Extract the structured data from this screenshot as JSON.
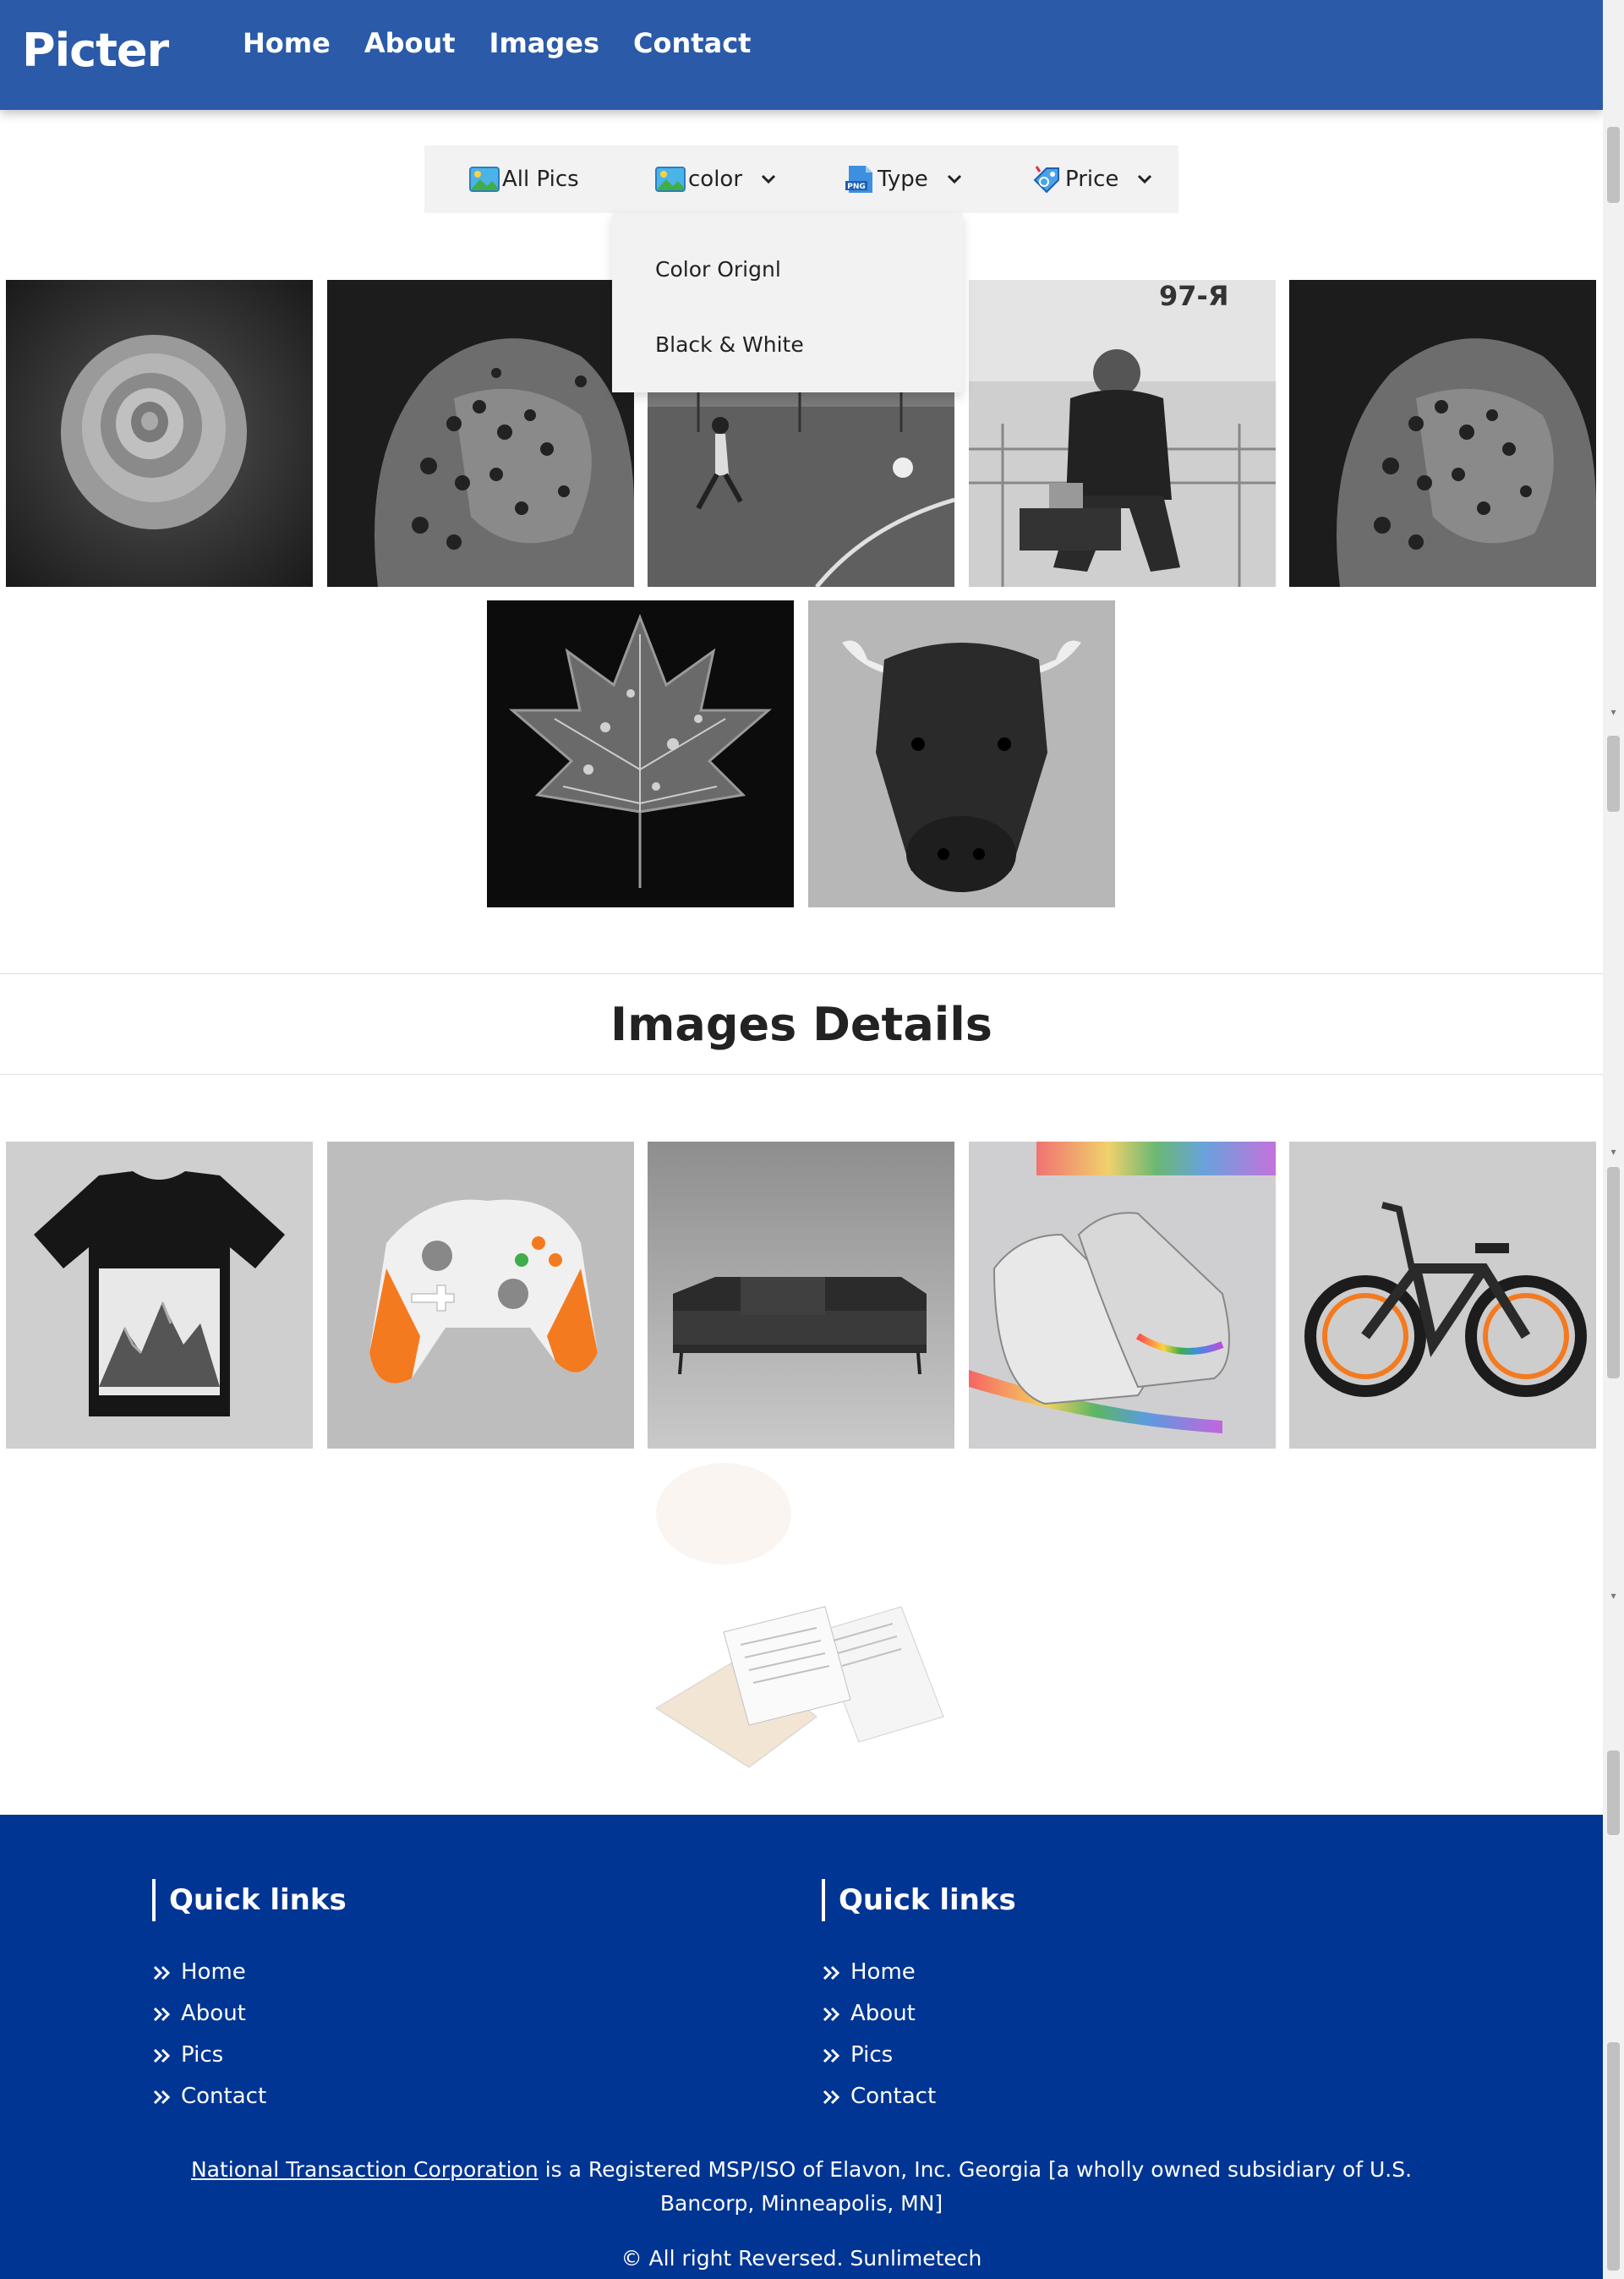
{
  "brand": "Picter",
  "nav": [
    "Home",
    "About",
    "Images",
    "Contact"
  ],
  "filters": {
    "all": "All Pics",
    "color": "color",
    "type": "Type",
    "price": "Price",
    "type_badge": "PNG"
  },
  "dropdown": [
    "Color Orignl",
    "Black & White"
  ],
  "gallery_bw": [
    "rose",
    "leopard",
    "football-player",
    "strongman",
    "leopard",
    "leaf",
    "bull"
  ],
  "section_title": "Images Details",
  "gallery_products": [
    "t-shirt",
    "game-controller",
    "sofa",
    "sneakers",
    "e-bike",
    "books"
  ],
  "footer": {
    "col1": {
      "title": "Quick links",
      "links": [
        "Home",
        "About",
        "Pics",
        "Contact"
      ]
    },
    "col2": {
      "title": "Quick links",
      "links": [
        "Home",
        "About",
        "Pics",
        "Contact"
      ]
    },
    "note_link": "National Transaction Corporation",
    "note_text": " is a Registered MSP/ISO of Elavon, Inc. Georgia [a wholly owned subsidiary of U.S. Bancorp, Minneapolis, MN]",
    "copyright": "© All right Reversed.  Sunlimetech"
  },
  "colors": {
    "navbar": "#2a5aa8",
    "footer": "#003593",
    "filterbar": "#f2f2f2"
  }
}
